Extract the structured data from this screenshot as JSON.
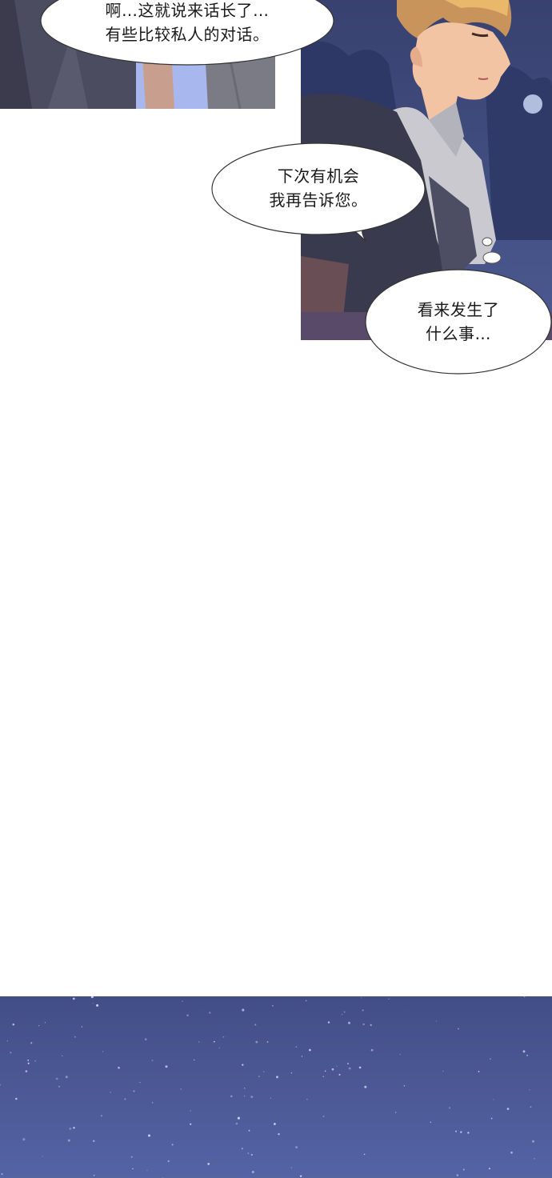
{
  "dialogue": {
    "line1": "啊…这就说来话长了…\n有些比较私人的对话。",
    "line2": "下次有机会\n我再告诉您。",
    "line3": "看来发生了\n什么事…"
  },
  "colors": {
    "night_sky": "#3f4f8f",
    "night_sky_light": "#5565a6",
    "hair": "#c9945b",
    "skin": "#f2c4a4",
    "shirt": "#c9c9cf",
    "vest": "#3a3a4e",
    "coat": "#4d4d63",
    "bubble_fill": "#ffffff",
    "bubble_stroke": "#333333"
  }
}
